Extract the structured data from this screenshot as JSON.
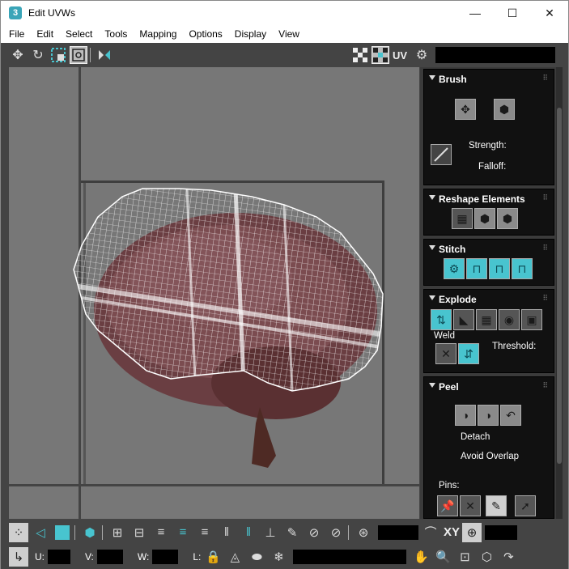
{
  "window": {
    "app_icon": "3",
    "title": "Edit UVWs",
    "controls": {
      "minimize": "—",
      "maximize": "☐",
      "close": "✕"
    }
  },
  "menu": [
    "File",
    "Edit",
    "Select",
    "Tools",
    "Mapping",
    "Options",
    "Display",
    "View"
  ],
  "toolbar": {
    "uv_label": "UV",
    "icons": [
      "move-icon",
      "rotate-icon",
      "scale-icon",
      "freeform-icon",
      "mirror-icon",
      "checker-icon",
      "checker-selected-icon",
      "uv-settings-icon"
    ]
  },
  "panel": {
    "brush": {
      "title": "Brush",
      "strength_label": "Strength:",
      "falloff_label": "Falloff:"
    },
    "reshape": {
      "title": "Reshape Elements"
    },
    "stitch": {
      "title": "Stitch"
    },
    "explode": {
      "title": "Explode",
      "weld_label": "Weld",
      "threshold_label": "Threshold:"
    },
    "peel": {
      "title": "Peel",
      "detach_label": "Detach",
      "avoid_overlap_label": "Avoid Overlap",
      "pins_label": "Pins:"
    }
  },
  "bottombar": {
    "xy_label": "XY",
    "u_label": "U:",
    "v_label": "V:",
    "w_label": "W:",
    "l_label": "L:"
  },
  "colors": {
    "accent": "#48c4cf",
    "panel_bg": "#3b3b3b",
    "rollout_bg": "#111111",
    "viewport_bg": "#777777"
  }
}
